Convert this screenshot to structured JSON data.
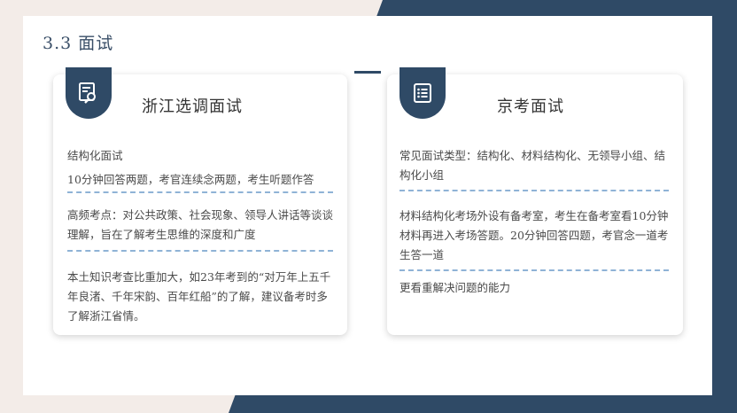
{
  "page": {
    "title": "3.3 面试"
  },
  "cards": [
    {
      "title": "浙江选调面试",
      "icon": "document-magnify-icon",
      "sections": [
        {
          "text": "结构化面试"
        },
        {
          "text": "10分钟回答两题，考官连续念两题，考生听题作答"
        },
        {
          "text": "高频考点：对公共政策、社会现象、领导人讲话等谈谈理解，旨在了解考生思维的深度和广度"
        },
        {
          "text": "本土知识考查比重加大，如23年考到的“对万年上五千年良渚、千年宋韵、百年红船”的了解，建议备考时多了解浙江省情。"
        }
      ]
    },
    {
      "title": "京考面试",
      "icon": "list-document-icon",
      "sections": [
        {
          "text": "常见面试类型：结构化、材料结构化、无领导小组、结构化小组"
        },
        {
          "text": "材料结构化考场外设有备考室，考生在备考室看10分钟材料再进入考场答题。20分钟回答四题，考官念一道考生答一道"
        },
        {
          "text": "更看重解决问题的能力"
        }
      ]
    }
  ],
  "colors": {
    "navy": "#2f4a66",
    "dash": "#8fb3d6",
    "background": "#f3ece8"
  }
}
